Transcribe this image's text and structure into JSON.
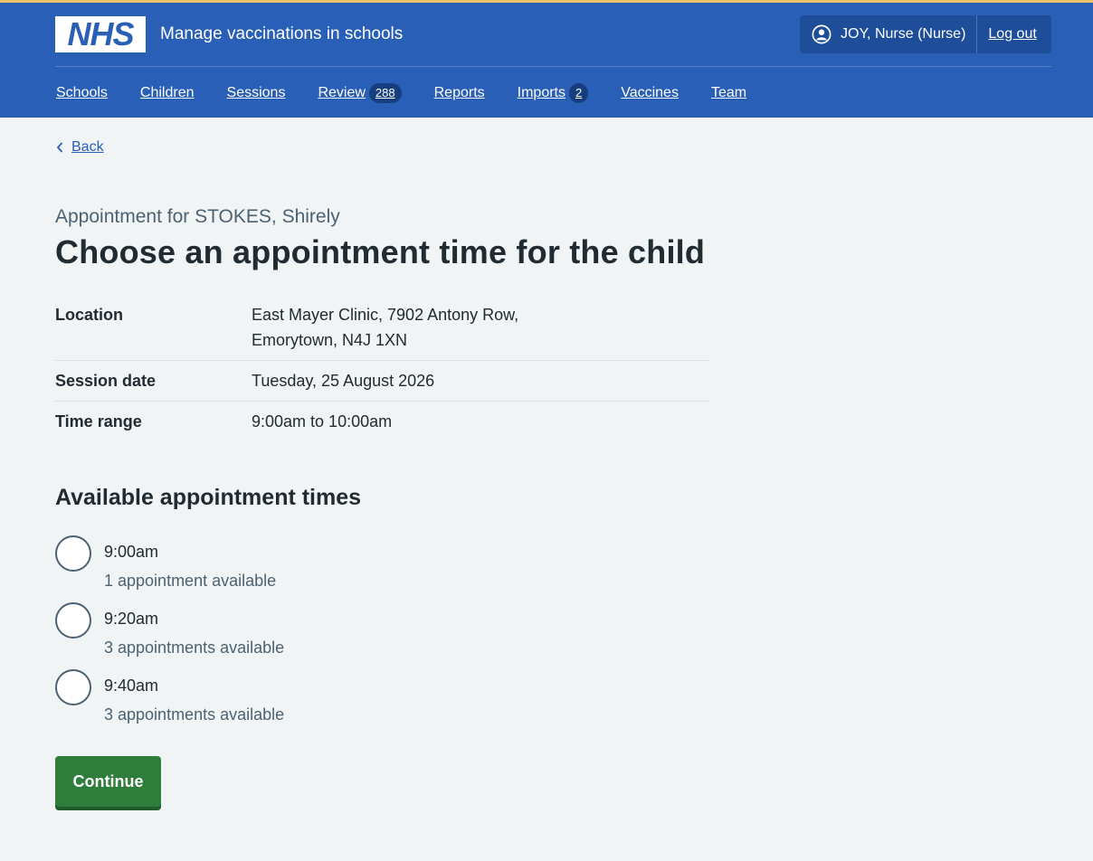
{
  "header": {
    "logo_text": "NHS",
    "service_name": "Manage vaccinations in schools",
    "user_label": "JOY, Nurse (Nurse)",
    "logout_label": "Log out",
    "colors": {
      "header_bg": "#2a5fb7",
      "accent_bar": "#f0c36a"
    }
  },
  "nav": {
    "items": [
      {
        "label": "Schools"
      },
      {
        "label": "Children"
      },
      {
        "label": "Sessions"
      },
      {
        "label": "Review",
        "badge": "288"
      },
      {
        "label": "Reports"
      },
      {
        "label": "Imports",
        "badge": "2"
      },
      {
        "label": "Vaccines"
      },
      {
        "label": "Team"
      }
    ]
  },
  "back_label": "Back",
  "page": {
    "caption": "Appointment for STOKES, Shirely",
    "title": "Choose an appointment time for the child"
  },
  "summary": [
    {
      "key": "Location",
      "value": "East Mayer Clinic, 7902 Antony Row,",
      "value2": "Emorytown, N4J 1XN"
    },
    {
      "key": "Session date",
      "value": "Tuesday, 25 August 2026"
    },
    {
      "key": "Time range",
      "value": "9:00am to 10:00am"
    }
  ],
  "appointments": {
    "heading": "Available appointment times",
    "options": [
      {
        "time": "9:00am",
        "hint": "1 appointment available"
      },
      {
        "time": "9:20am",
        "hint": "3 appointments available"
      },
      {
        "time": "9:40am",
        "hint": "3 appointments available"
      }
    ]
  },
  "continue_label": "Continue",
  "continue_color": "#2e7d3b"
}
